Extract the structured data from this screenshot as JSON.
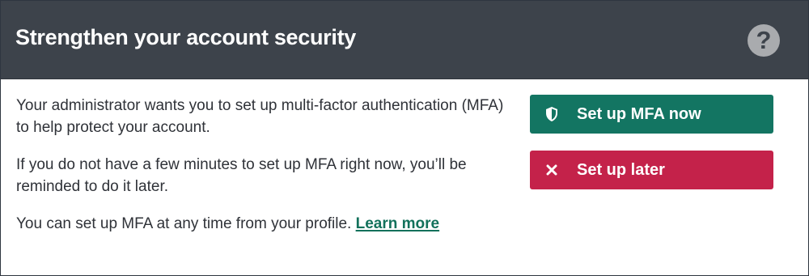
{
  "dialog": {
    "title": "Strengthen your account security",
    "help_icon": "question-mark-icon",
    "help_glyph": "?"
  },
  "body": {
    "paragraph_1": "Your administrator wants you to set up multi-factor authentication (MFA) to help protect your account.",
    "paragraph_2": "If you do not have a few minutes to set up MFA right now, you’ll be reminded to do it later.",
    "paragraph_3_text": "You can set up MFA at any time from your profile. ",
    "learn_more_label": "Learn more"
  },
  "actions": {
    "setup_now_label": "Set up MFA now",
    "setup_now_icon": "shield-icon",
    "setup_later_label": "Set up later",
    "setup_later_icon": "close-icon"
  },
  "colors": {
    "header_bg": "#3d434b",
    "primary_button": "#137562",
    "secondary_button": "#c4224a",
    "link": "#12715b"
  }
}
